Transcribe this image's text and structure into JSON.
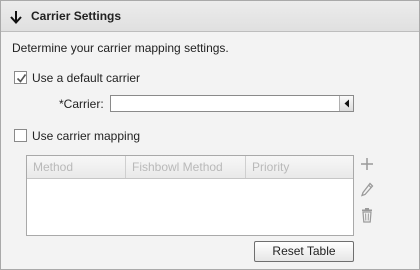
{
  "header": {
    "title": "Carrier Settings",
    "icon": "arrow-down-icon"
  },
  "description": "Determine your carrier mapping settings.",
  "default_carrier": {
    "label": "Use a default carrier",
    "checked": true
  },
  "carrier_field": {
    "label": "*Carrier:",
    "value": ""
  },
  "carrier_mapping": {
    "label": "Use carrier mapping",
    "checked": false
  },
  "table": {
    "columns": [
      "Method",
      "Fishbowl Method",
      "Priority"
    ],
    "rows": []
  },
  "actions": {
    "add_icon": "plus-icon",
    "edit_icon": "pencil-icon",
    "delete_icon": "trash-icon"
  },
  "reset_button": "Reset Table",
  "colors": {
    "header_bg": "#e4e4e4",
    "panel_bg": "#f3f3f3",
    "disabled_text": "#b9b9b9"
  }
}
